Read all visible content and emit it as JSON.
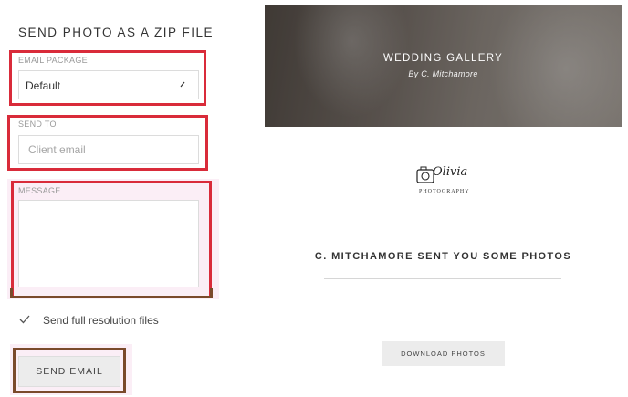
{
  "panel": {
    "title": "SEND PHOTO AS A ZIP FILE",
    "email_package": {
      "label": "EMAIL PACKAGE",
      "value": "Default"
    },
    "send_to": {
      "label": "SEND TO",
      "placeholder": "Client email"
    },
    "message": {
      "label": "MESSAGE",
      "value": ""
    },
    "full_resolution": {
      "label": "Send full resolution files",
      "checked": true
    },
    "send_button": "SEND EMAIL"
  },
  "preview": {
    "gallery_title": "WEDDING GALLERY",
    "gallery_byline": "By C. Mitchamore",
    "logo": {
      "script": "Olivia",
      "sub": "PHOTOGRAPHY"
    },
    "message": "C. MITCHAMORE SENT YOU SOME PHOTOS",
    "download_button": "DOWNLOAD PHOTOS"
  },
  "colors": {
    "highlight_red": "#d92b3a",
    "highlight_brown": "#7a4a2b",
    "highlight_pink": "#fbeef6"
  }
}
